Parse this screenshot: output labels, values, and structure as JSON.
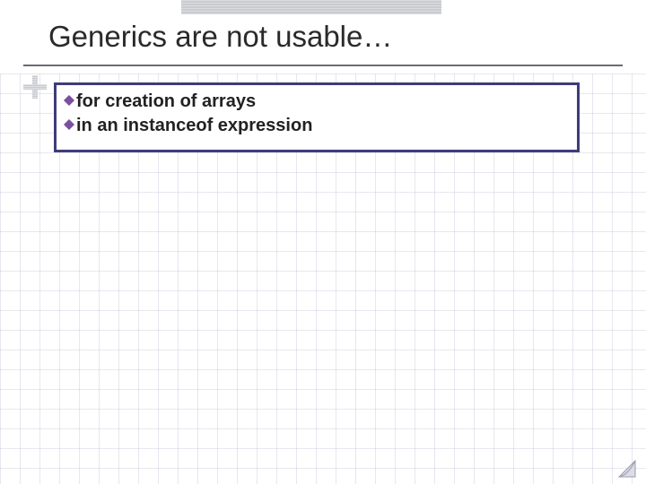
{
  "title": "Generics are not usable…",
  "bullets": [
    {
      "text": "for creation of arrays"
    },
    {
      "text": "in an instanceof expression"
    }
  ],
  "colors": {
    "border": "#3d3d7a",
    "bullet": "#7a4fa0",
    "underline": "#6a6a72",
    "decor": "#c9cbd0"
  }
}
